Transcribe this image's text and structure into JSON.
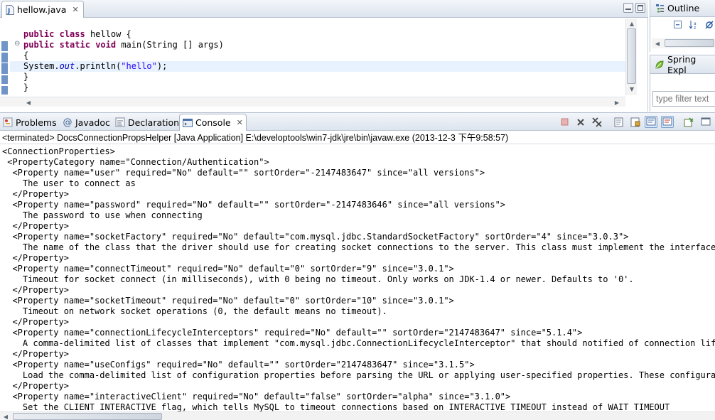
{
  "editor": {
    "tab_label": "hellow.java",
    "code_lines": [
      {
        "parts": [
          {
            "t": "public",
            "c": "kw"
          },
          {
            "t": " "
          },
          {
            "t": "class",
            "c": "kw"
          },
          {
            "t": " hellow {"
          }
        ]
      },
      {
        "parts": [
          {
            "t": "public",
            "c": "kw"
          },
          {
            "t": " "
          },
          {
            "t": "static",
            "c": "kw"
          },
          {
            "t": " "
          },
          {
            "t": "void",
            "c": "kw"
          },
          {
            "t": " main(String [] args)"
          }
        ]
      },
      {
        "parts": [
          {
            "t": "{"
          }
        ]
      },
      {
        "parts": [
          {
            "t": "System."
          },
          {
            "t": "out",
            "c": "fld"
          },
          {
            "t": ".println("
          },
          {
            "t": "\"hello\"",
            "c": "str"
          },
          {
            "t": ");"
          }
        ],
        "current": true
      },
      {
        "parts": [
          {
            "t": "}"
          }
        ]
      },
      {
        "parts": [
          {
            "t": "}"
          }
        ]
      }
    ]
  },
  "outline": {
    "tab_label": "Outline"
  },
  "spring": {
    "tab_label": "Spring Expl",
    "filter_placeholder": "type filter text"
  },
  "console": {
    "tabs": [
      {
        "label": "Problems",
        "icon": "problems-icon"
      },
      {
        "label": "Javadoc",
        "icon": "javadoc-icon"
      },
      {
        "label": "Declaration",
        "icon": "declaration-icon"
      },
      {
        "label": "Console",
        "icon": "console-icon",
        "active": true
      }
    ],
    "header": "<terminated> DocsConnectionPropsHelper [Java Application] E:\\developtools\\win7-jdk\\jre\\bin\\javaw.exe (2013-12-3 下午9:58:57)",
    "lines": [
      "<ConnectionProperties>",
      " <PropertyCategory name=\"Connection/Authentication\">",
      "  <Property name=\"user\" required=\"No\" default=\"\" sortOrder=\"-2147483647\" since=\"all versions\">",
      "    The user to connect as",
      "  </Property>",
      "  <Property name=\"password\" required=\"No\" default=\"\" sortOrder=\"-2147483646\" since=\"all versions\">",
      "    The password to use when connecting",
      "  </Property>",
      "  <Property name=\"socketFactory\" required=\"No\" default=\"com.mysql.jdbc.StandardSocketFactory\" sortOrder=\"4\" since=\"3.0.3\">",
      "    The name of the class that the driver should use for creating socket connections to the server. This class must implement the interface 'com",
      "  </Property>",
      "  <Property name=\"connectTimeout\" required=\"No\" default=\"0\" sortOrder=\"9\" since=\"3.0.1\">",
      "    Timeout for socket connect (in milliseconds), with 0 being no timeout. Only works on JDK-1.4 or newer. Defaults to '0'.",
      "  </Property>",
      "  <Property name=\"socketTimeout\" required=\"No\" default=\"0\" sortOrder=\"10\" since=\"3.0.1\">",
      "    Timeout on network socket operations (0, the default means no timeout).",
      "  </Property>",
      "  <Property name=\"connectionLifecycleInterceptors\" required=\"No\" default=\"\" sortOrder=\"2147483647\" since=\"5.1.4\">",
      "    A comma-delimited list of classes that implement \"com.mysql.jdbc.ConnectionLifecycleInterceptor\" that should notified of connection lifecycl",
      "  </Property>",
      "  <Property name=\"useConfigs\" required=\"No\" default=\"\" sortOrder=\"2147483647\" since=\"3.1.5\">",
      "    Load the comma-delimited list of configuration properties before parsing the URL or applying user-specified properties. These configuration",
      "  </Property>",
      "  <Property name=\"interactiveClient\" required=\"No\" default=\"false\" sortOrder=\"alpha\" since=\"3.1.0\">",
      "    Set the CLIENT_INTERACTIVE flag, which tells MySQL to timeout connections based on INTERACTIVE_TIMEOUT instead of WAIT_TIMEOUT"
    ]
  }
}
